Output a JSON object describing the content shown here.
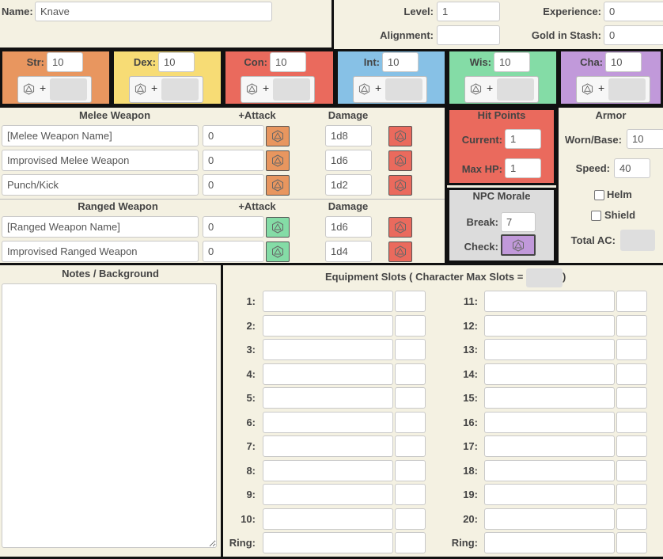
{
  "header": {
    "name_label": "Name:",
    "name_value": "Knave",
    "level_label": "Level:",
    "level_value": "1",
    "experience_label": "Experience:",
    "experience_value": "0",
    "alignment_label": "Alignment:",
    "alignment_value": "",
    "gold_label": "Gold in Stash:",
    "gold_value": "0"
  },
  "abilities": [
    {
      "label": "Str:",
      "value": "10",
      "color": "#e8965f"
    },
    {
      "label": "Dex:",
      "value": "10",
      "color": "#f7dc75"
    },
    {
      "label": "Con:",
      "value": "10",
      "color": "#ea6a5d"
    },
    {
      "label": "Int:",
      "value": "10",
      "color": "#87c1e6"
    },
    {
      "label": "Wis:",
      "value": "10",
      "color": "#84dca6"
    },
    {
      "label": "Cha:",
      "value": "10",
      "color": "#c199da"
    }
  ],
  "plus_sign": "+",
  "weapons": {
    "melee_header": "Melee Weapon",
    "attack_header": "+Attack",
    "damage_header": "Damage",
    "melee": [
      {
        "name": "[Melee Weapon Name]",
        "attack": "0",
        "damage": "1d8"
      },
      {
        "name": "Improvised Melee Weapon",
        "attack": "0",
        "damage": "1d6"
      },
      {
        "name": "Punch/Kick",
        "attack": "0",
        "damage": "1d2"
      }
    ],
    "ranged_header": "Ranged Weapon",
    "ranged": [
      {
        "name": "[Ranged Weapon Name]",
        "attack": "0",
        "damage": "1d6"
      },
      {
        "name": "Improvised Ranged Weapon",
        "attack": "0",
        "damage": "1d4"
      }
    ]
  },
  "hit_points": {
    "title": "Hit Points",
    "current_label": "Current:",
    "current_value": "1",
    "max_label": "Max HP:",
    "max_value": "1",
    "color": "#ea6a5d"
  },
  "morale": {
    "title": "NPC Morale",
    "break_label": "Break:",
    "break_value": "7",
    "check_label": "Check:",
    "color": "#c199da"
  },
  "armor": {
    "title": "Armor",
    "worn_label": "Worn/Base:",
    "worn_value": "10",
    "speed_label": "Speed:",
    "speed_value": "40",
    "helm_label": "Helm",
    "shield_label": "Shield",
    "total_label": "Total AC:"
  },
  "notes": {
    "title": "Notes / Background",
    "value": ""
  },
  "equipment": {
    "title_prefix": "Equipment Slots ( Character Max Slots =",
    "title_suffix": ")",
    "left_slots": [
      "1:",
      "2:",
      "3:",
      "4:",
      "5:",
      "6:",
      "7:",
      "8:",
      "9:",
      "10:",
      "Ring:"
    ],
    "right_slots": [
      "11:",
      "12:",
      "13:",
      "14:",
      "15:",
      "16:",
      "17:",
      "18:",
      "19:",
      "20:",
      "Ring:"
    ]
  },
  "icons": {
    "die": "d20-die-icon"
  },
  "colors": {
    "melee_attack": "#e8965f",
    "ranged_attack": "#84dca6",
    "damage": "#ea6a5d",
    "background": "#f4f1e2"
  }
}
